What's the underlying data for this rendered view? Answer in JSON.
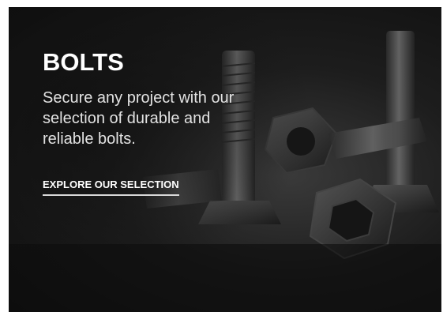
{
  "card": {
    "title": "BOLTS",
    "description": "Secure any project with our selection of durable and reliable bolts.",
    "cta_label": "EXPLORE OUR SELECTION",
    "background_image": "bolts-and-nuts-photo",
    "colors": {
      "background": "#1d1d1d",
      "title": "#ffffff",
      "text": "#e2e2e2",
      "underline": "#d9d9d9"
    }
  }
}
